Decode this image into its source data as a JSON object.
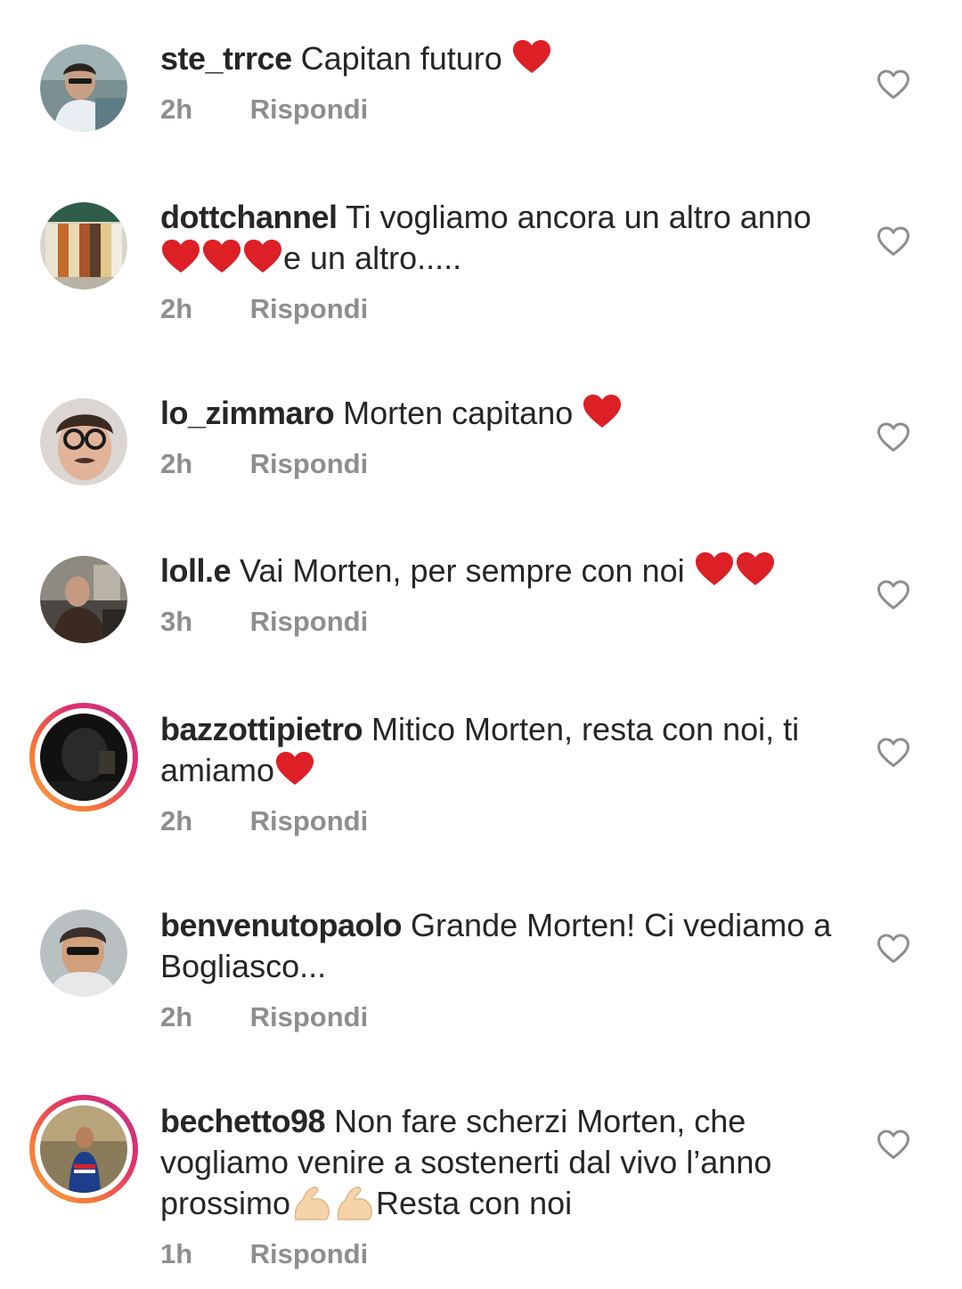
{
  "comments": [
    {
      "username": "ste_trrce",
      "text_before": "Capitan futuro ",
      "hearts": 1,
      "text_after": "",
      "time": "2h",
      "reply": "Rispondi"
    },
    {
      "username": "dottchannel",
      "text_before": "Ti vogliamo ancora un altro anno",
      "hearts": 3,
      "text_after": "e un altro.....",
      "time": "2h",
      "reply": "Rispondi"
    },
    {
      "username": "lo_zimmaro",
      "text_before": "Morten capitano ",
      "hearts": 1,
      "text_after": "",
      "time": "2h",
      "reply": "Rispondi"
    },
    {
      "username": "loll.e",
      "text_before": "Vai Morten, per sempre con noi ",
      "hearts": 2,
      "text_after": "",
      "time": "3h",
      "reply": "Rispondi"
    },
    {
      "username": "bazzottipietro",
      "text_before": "Mitico Morten, resta con noi, ti amiamo",
      "hearts": 1,
      "text_after": "",
      "time": "2h",
      "reply": "Rispondi"
    },
    {
      "username": "benvenutopaolo",
      "text_before": "Grande Morten! Ci vediamo a Bogliasco...",
      "hearts": 0,
      "text_after": "",
      "time": "2h",
      "reply": "Rispondi"
    },
    {
      "username": "bechetto98",
      "text_before": "Non fare scherzi Morten, che vogliamo venire a sostenerti dal vivo l’anno prossimo",
      "arms": 2,
      "text_after": "Resta con noi",
      "time": "1h",
      "reply": "Rispondi"
    }
  ],
  "icons": {
    "like": "heart-outline-icon",
    "emoji_heart": "red-heart-emoji",
    "emoji_arm": "flexed-biceps-emoji"
  },
  "colors": {
    "text": "#262626",
    "meta": "#8e8e8e",
    "heart": "#e0202a",
    "story_ring_start": "#f6a34c",
    "story_ring_end": "#c13584"
  }
}
